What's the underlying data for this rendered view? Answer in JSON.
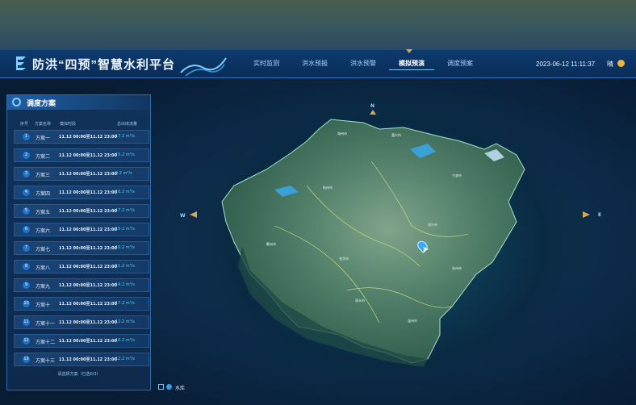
{
  "header": {
    "title": "防洪“四预”智慧水利平台",
    "tabs": [
      {
        "label": "实时监测",
        "active": false
      },
      {
        "label": "洪水预报",
        "active": false
      },
      {
        "label": "洪水预警",
        "active": false
      },
      {
        "label": "模拟预演",
        "active": true
      },
      {
        "label": "调度预案",
        "active": false
      }
    ],
    "datetime": "2023-06-12 11:11:37",
    "weather": "晴"
  },
  "panel": {
    "title": "调度方案",
    "columns": [
      "序号",
      "方案名称",
      "模拟时段",
      "总出库流量"
    ],
    "rows": [
      {
        "num": "1",
        "name": "方案一",
        "time": "11.12 00:00至11.12 23:00",
        "flow": "17.2 m³/s"
      },
      {
        "num": "2",
        "name": "方案二",
        "time": "11.12 00:00至11.12 23:00",
        "flow": "15.2 m³/s"
      },
      {
        "num": "3",
        "name": "方案三",
        "time": "11.12 00:00至11.12 23:00",
        "flow": "9.2 m³/s"
      },
      {
        "num": "4",
        "name": "方案四",
        "time": "11.12 00:00至11.12 23:00",
        "flow": "16.2 m³/s"
      },
      {
        "num": "5",
        "name": "方案五",
        "time": "11.12 00:00至11.12 23:00",
        "flow": "17.2 m³/s"
      },
      {
        "num": "6",
        "name": "方案六",
        "time": "11.12 00:00至11.12 23:00",
        "flow": "15.2 m³/s"
      },
      {
        "num": "7",
        "name": "方案七",
        "time": "11.12 00:00至11.12 23:00",
        "flow": "10.2 m³/s"
      },
      {
        "num": "8",
        "name": "方案八",
        "time": "11.12 00:00至11.12 23:00",
        "flow": "11.2 m³/s"
      },
      {
        "num": "9",
        "name": "方案九",
        "time": "11.12 00:00至11.12 23:00",
        "flow": "14.2 m³/s"
      },
      {
        "num": "10",
        "name": "方案十",
        "time": "11.12 00:00至11.12 23:00",
        "flow": "17.2 m³/s"
      },
      {
        "num": "11",
        "name": "方案十一",
        "time": "11.12 00:00至11.12 23:00",
        "flow": "12.2 m³/s"
      },
      {
        "num": "12",
        "name": "方案十二",
        "time": "11.12 00:00至11.12 23:00",
        "flow": "10.2 m³/s"
      },
      {
        "num": "13",
        "name": "方案十三",
        "time": "11.12 00:00至11.12 23:00",
        "flow": "12.2 m³/s"
      }
    ],
    "select_label": "请选择方案（已选0/3）"
  },
  "map": {
    "compass": {
      "north": "N",
      "west": "W",
      "east": "E"
    },
    "labels": [
      "湖州市",
      "嘉兴市",
      "杭州市",
      "金华市",
      "衢州市",
      "丽水市",
      "温州市",
      "宁波市",
      "绍兴市",
      "台州市"
    ]
  },
  "legend": {
    "label": "水库"
  },
  "colors": {
    "accent": "#2f78c0",
    "active_tab": "#6fc8ff",
    "flow_text": "#5fd2ff",
    "header_bg": "#0d3a6e"
  }
}
